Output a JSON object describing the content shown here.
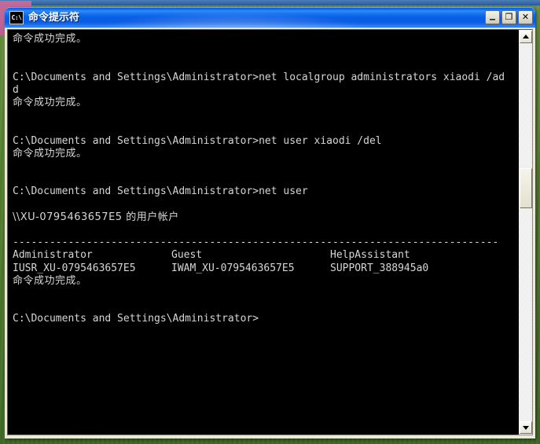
{
  "window": {
    "title": "命令提示符",
    "icon": "cmd-icon",
    "icon_text": "C:\\",
    "controls": {
      "minimize": "_",
      "maximize": "❐",
      "close": "✕"
    }
  },
  "console": {
    "prompt": "C:\\Documents and Settings\\Administrator>",
    "lines": [
      {
        "type": "text",
        "text": "命令成功完成。",
        "cjk": true
      },
      {
        "type": "blank",
        "text": ""
      },
      {
        "type": "blank",
        "text": ""
      },
      {
        "type": "command",
        "text": "C:\\Documents and Settings\\Administrator>net localgroup administrators xiaodi /ad"
      },
      {
        "type": "command-wrap",
        "text": "d"
      },
      {
        "type": "text",
        "text": "命令成功完成。",
        "cjk": true
      },
      {
        "type": "blank",
        "text": ""
      },
      {
        "type": "blank",
        "text": ""
      },
      {
        "type": "command",
        "text": "C:\\Documents and Settings\\Administrator>net user xiaodi /del"
      },
      {
        "type": "text",
        "text": "命令成功完成。",
        "cjk": true
      },
      {
        "type": "blank",
        "text": ""
      },
      {
        "type": "blank",
        "text": ""
      },
      {
        "type": "command",
        "text": "C:\\Documents and Settings\\Administrator>net user"
      },
      {
        "type": "blank",
        "text": ""
      },
      {
        "type": "text",
        "text": "\\\\XU-0795463657E5 的用户帐户",
        "cjk": true
      },
      {
        "type": "blank",
        "text": ""
      },
      {
        "type": "rule",
        "text": "-------------------------------------------------------------------------------"
      },
      {
        "type": "columns",
        "cells": [
          "Administrator",
          "Guest",
          "HelpAssistant"
        ]
      },
      {
        "type": "columns",
        "cells": [
          "IUSR_XU-0795463657E5",
          "IWAM_XU-0795463657E5",
          "SUPPORT_388945a0"
        ]
      },
      {
        "type": "text",
        "text": "命令成功完成。",
        "cjk": true
      },
      {
        "type": "blank",
        "text": ""
      },
      {
        "type": "blank",
        "text": ""
      },
      {
        "type": "command",
        "text": "C:\\Documents and Settings\\Administrator>"
      }
    ],
    "host_name": "\\\\XU-0795463657E5",
    "host_caption": "的用户帐户",
    "success_message": "命令成功完成。",
    "commands_issued": [
      "net localgroup administrators xiaodi /add",
      "net user xiaodi /del",
      "net user"
    ],
    "user_accounts": [
      "Administrator",
      "Guest",
      "HelpAssistant",
      "IUSR_XU-0795463657E5",
      "IWAM_XU-0795463657E5",
      "SUPPORT_388945a0"
    ]
  },
  "scrollbar": {
    "up_arrow": "▲",
    "down_arrow": "▼",
    "thumb_label": "scroll-thumb"
  },
  "colors": {
    "titlebar_blue": "#0a5ce3",
    "console_bg": "#000000",
    "console_fg": "#d6d6d6",
    "window_face": "#ece9d8",
    "desktop_green": "#55812f"
  }
}
